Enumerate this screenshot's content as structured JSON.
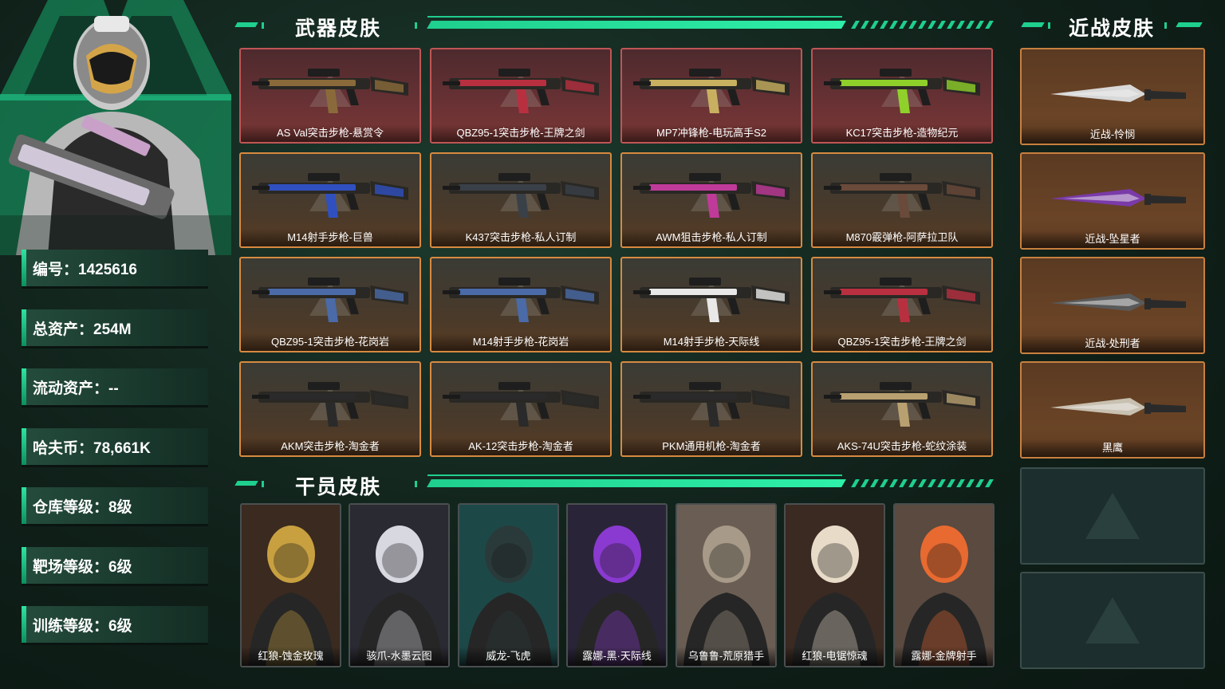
{
  "player": {
    "stats": [
      {
        "label": "编号：",
        "value": "1425616"
      },
      {
        "label": "总资产：",
        "value": "254M"
      },
      {
        "label": "流动资产：",
        "value": "--"
      },
      {
        "label": "哈夫币：",
        "value": "78,661K"
      },
      {
        "label": "仓库等级：",
        "value": "8级"
      },
      {
        "label": "靶场等级：",
        "value": "6级"
      },
      {
        "label": "训练等级：",
        "value": "6级"
      }
    ]
  },
  "sections": {
    "weapons_title": "武器皮肤",
    "melee_title": "近战皮肤",
    "operators_title": "干员皮肤"
  },
  "weapons": [
    {
      "name": "AS Val突击步枪-悬赏令",
      "rarity": "red",
      "accent": "#8a6a3a"
    },
    {
      "name": "QBZ95-1突击步枪-王牌之剑",
      "rarity": "red",
      "accent": "#b83040"
    },
    {
      "name": "MP7冲锋枪-电玩高手S2",
      "rarity": "red",
      "accent": "#c8b060"
    },
    {
      "name": "KC17突击步枪-造物纪元",
      "rarity": "red",
      "accent": "#8fd02a"
    },
    {
      "name": "M14射手步枪-巨兽",
      "rarity": "gold",
      "accent": "#3050c0"
    },
    {
      "name": "K437突击步枪-私人订制",
      "rarity": "gold",
      "accent": "#3a4048"
    },
    {
      "name": "AWM狙击步枪-私人订制",
      "rarity": "gold",
      "accent": "#c03a9a"
    },
    {
      "name": "M870霰弹枪-阿萨拉卫队",
      "rarity": "gold",
      "accent": "#6a4a3a"
    },
    {
      "name": "QBZ95-1突击步枪-花岗岩",
      "rarity": "gold",
      "accent": "#4a6aa8"
    },
    {
      "name": "M14射手步枪-花岗岩",
      "rarity": "gold",
      "accent": "#4a6aa8"
    },
    {
      "name": "M14射手步枪-天际线",
      "rarity": "gold",
      "accent": "#e8e8e8"
    },
    {
      "name": "QBZ95-1突击步枪-王牌之剑",
      "rarity": "gold",
      "accent": "#b83040"
    },
    {
      "name": "AKM突击步枪-淘金者",
      "rarity": "gold",
      "accent": "#2a2a2a"
    },
    {
      "name": "AK-12突击步枪-淘金者",
      "rarity": "gold",
      "accent": "#2a2a2a"
    },
    {
      "name": "PKM通用机枪-淘金者",
      "rarity": "gold",
      "accent": "#2a2a2a"
    },
    {
      "name": "AKS-74U突击步枪-蛇纹涂装",
      "rarity": "gold",
      "accent": "#b8a070"
    }
  ],
  "melee": [
    {
      "name": "近战-怜悯",
      "accent": "#d8d8d8"
    },
    {
      "name": "近战-坠星者",
      "accent": "#7a3aa8"
    },
    {
      "name": "近战-处刑者",
      "accent": "#5a5a5a"
    },
    {
      "name": "黑鹰",
      "accent": "#c8c0b0"
    }
  ],
  "operators": [
    {
      "name": "红狼-蚀金玫瑰",
      "accent": "#c8a040",
      "bg": "#3a2a20"
    },
    {
      "name": "骇爪-水墨云图",
      "accent": "#d8d8e0",
      "bg": "#2a2a32"
    },
    {
      "name": "威龙-飞虎",
      "accent": "#2a3a3a",
      "bg": "#1d4848"
    },
    {
      "name": "露娜-黑·天际线",
      "accent": "#8a3ad0",
      "bg": "#2a2438"
    },
    {
      "name": "乌鲁鲁-荒原猎手",
      "accent": "#a89a88",
      "bg": "#6a5e54"
    },
    {
      "name": "红狼-电锯惊魂",
      "accent": "#e8dcc8",
      "bg": "#3a2a22"
    },
    {
      "name": "露娜-金牌射手",
      "accent": "#e86a30",
      "bg": "#5a4a40"
    }
  ]
}
